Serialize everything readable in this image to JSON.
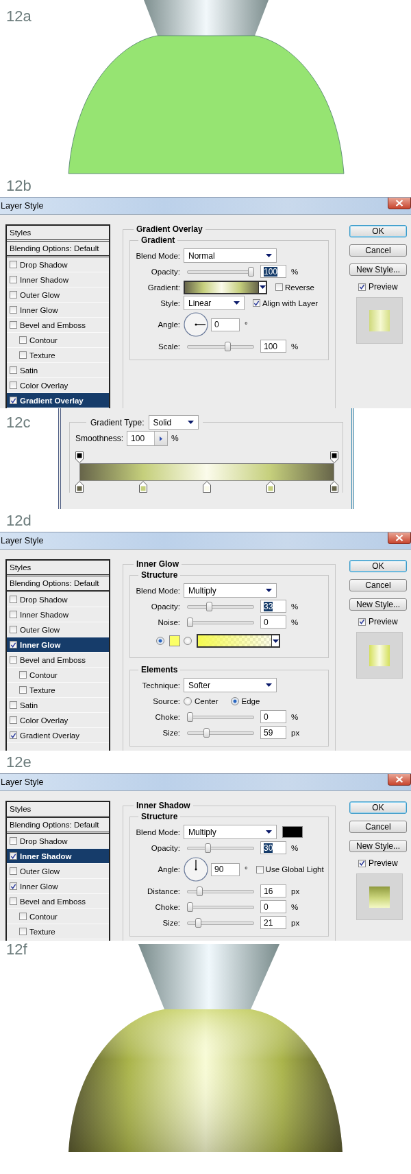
{
  "steps": [
    {
      "label": "12a",
      "kind": "flat_shape"
    },
    {
      "label": "12b",
      "kind": "dialog",
      "title": "Layer Style",
      "styles": {
        "header": "Styles",
        "blending": "Blending Options: Default",
        "items": [
          {
            "label": "Drop Shadow",
            "checked": false,
            "selected": false
          },
          {
            "label": "Inner Shadow",
            "checked": false,
            "selected": false
          },
          {
            "label": "Outer Glow",
            "checked": false,
            "selected": false
          },
          {
            "label": "Inner Glow",
            "checked": false,
            "selected": false
          },
          {
            "label": "Bevel and Emboss",
            "checked": false,
            "selected": false,
            "children": [
              {
                "label": "Contour",
                "checked": false,
                "selected": false
              },
              {
                "label": "Texture",
                "checked": false,
                "selected": false
              }
            ]
          },
          {
            "label": "Satin",
            "checked": false,
            "selected": false
          },
          {
            "label": "Color Overlay",
            "checked": false,
            "selected": false
          },
          {
            "label": "Gradient Overlay",
            "checked": true,
            "selected": true
          }
        ]
      },
      "panel": {
        "title": "Gradient Overlay",
        "groups": [
          {
            "title": "Gradient",
            "rows": [
              {
                "kind": "select",
                "label": "Blend Mode:",
                "value": "Normal"
              },
              {
                "kind": "slider",
                "label": "Opacity:",
                "level": 1.0,
                "value": "100",
                "unit": "%",
                "highlighted": true
              },
              {
                "kind": "gradient",
                "label": "Gradient:",
                "checkbox": {
                  "label": "Reverse",
                  "checked": false
                }
              },
              {
                "kind": "select",
                "label": "Style:",
                "value": "Linear",
                "checkbox": {
                  "label": "Align with Layer",
                  "checked": true
                }
              },
              {
                "kind": "angle",
                "label": "Angle:",
                "value": "0",
                "unit": "°"
              },
              {
                "kind": "slider",
                "label": "Scale:",
                "level": 0.62,
                "value": "100",
                "unit": "%",
                "highlighted": false
              }
            ]
          }
        ]
      },
      "buttons": [
        {
          "label": "OK",
          "default": true
        },
        {
          "label": "Cancel",
          "default": false
        },
        {
          "label": "New Style...",
          "default": false
        }
      ],
      "preview": {
        "label": "Preview",
        "checked": true,
        "kind": "gradient"
      }
    },
    {
      "label": "12c",
      "kind": "gradient_editor",
      "type_label": "Gradient Type:",
      "type_value": "Solid",
      "smoothness_label": "Smoothness:",
      "smoothness_value": "100",
      "smoothness_unit": "%",
      "color_stops": [
        {
          "color": "#67654a"
        },
        {
          "color": "#c5cf7c"
        },
        {
          "color": "#fbfbeb"
        },
        {
          "color": "#c5cf7c"
        },
        {
          "color": "#67654a"
        }
      ]
    },
    {
      "label": "12d",
      "kind": "dialog",
      "title": "Layer Style",
      "styles": {
        "header": "Styles",
        "blending": "Blending Options: Default",
        "items": [
          {
            "label": "Drop Shadow",
            "checked": false,
            "selected": false
          },
          {
            "label": "Inner Shadow",
            "checked": false,
            "selected": false
          },
          {
            "label": "Outer Glow",
            "checked": false,
            "selected": false
          },
          {
            "label": "Inner Glow",
            "checked": true,
            "selected": true
          },
          {
            "label": "Bevel and Emboss",
            "checked": false,
            "selected": false,
            "children": [
              {
                "label": "Contour",
                "checked": false,
                "selected": false
              },
              {
                "label": "Texture",
                "checked": false,
                "selected": false
              }
            ]
          },
          {
            "label": "Satin",
            "checked": false,
            "selected": false
          },
          {
            "label": "Color Overlay",
            "checked": false,
            "selected": false
          },
          {
            "label": "Gradient Overlay",
            "checked": true,
            "selected": false
          }
        ]
      },
      "panel": {
        "title": "Inner Glow",
        "groups": [
          {
            "title": "Structure",
            "rows": [
              {
                "kind": "select",
                "label": "Blend Mode:",
                "value": "Multiply"
              },
              {
                "kind": "slider",
                "label": "Opacity:",
                "level": 0.32,
                "value": "33",
                "unit": "%",
                "highlighted": true
              },
              {
                "kind": "slider",
                "label": "Noise:",
                "level": 0,
                "value": "0",
                "unit": "%",
                "highlighted": false
              },
              {
                "kind": "color_choice",
                "options": [
                  {
                    "kind": "swatch",
                    "selected": true,
                    "color": "#fbff66"
                  },
                  {
                    "kind": "gradient",
                    "selected": false
                  }
                ]
              }
            ]
          },
          {
            "title": "Elements",
            "rows": [
              {
                "kind": "select",
                "label": "Technique:",
                "value": "Softer"
              },
              {
                "kind": "radio",
                "label": "Source:",
                "options": [
                  {
                    "label": "Center",
                    "selected": false
                  },
                  {
                    "label": "Edge",
                    "selected": true
                  }
                ]
              },
              {
                "kind": "slider",
                "label": "Choke:",
                "level": 0,
                "value": "0",
                "unit": "%",
                "highlighted": false
              },
              {
                "kind": "slider",
                "label": "Size:",
                "level": 0.27,
                "value": "59",
                "unit": "px",
                "highlighted": false
              }
            ]
          }
        ]
      },
      "buttons": [
        {
          "label": "OK",
          "default": true
        },
        {
          "label": "Cancel",
          "default": false
        },
        {
          "label": "New Style...",
          "default": false
        }
      ],
      "preview": {
        "label": "Preview",
        "checked": true,
        "kind": "glow"
      }
    },
    {
      "label": "12e",
      "kind": "dialog",
      "title": "Layer Style",
      "styles": {
        "header": "Styles",
        "blending": "Blending Options: Default",
        "items": [
          {
            "label": "Drop Shadow",
            "checked": false,
            "selected": false
          },
          {
            "label": "Inner Shadow",
            "checked": true,
            "selected": true
          },
          {
            "label": "Outer Glow",
            "checked": false,
            "selected": false
          },
          {
            "label": "Inner Glow",
            "checked": true,
            "selected": false
          },
          {
            "label": "Bevel and Emboss",
            "checked": false,
            "selected": false,
            "children": [
              {
                "label": "Contour",
                "checked": false,
                "selected": false
              },
              {
                "label": "Texture",
                "checked": false,
                "selected": false
              }
            ]
          }
        ]
      },
      "panel": {
        "title": "Inner Shadow",
        "groups": [
          {
            "title": "Structure",
            "rows": [
              {
                "kind": "select",
                "label": "Blend Mode:",
                "value": "Multiply",
                "color": "#000000"
              },
              {
                "kind": "slider",
                "label": "Opacity:",
                "level": 0.29,
                "value": "30",
                "unit": "%",
                "highlighted": true
              },
              {
                "kind": "angle",
                "label": "Angle:",
                "value": "90",
                "unit": "°",
                "checkbox": {
                  "label": "Use Global Light",
                  "checked": false
                }
              },
              {
                "kind": "slider",
                "label": "Distance:",
                "level": 0.16,
                "value": "16",
                "unit": "px",
                "highlighted": false
              },
              {
                "kind": "slider",
                "label": "Choke:",
                "level": 0,
                "value": "0",
                "unit": "%",
                "highlighted": false
              },
              {
                "kind": "slider",
                "label": "Size:",
                "level": 0.14,
                "value": "21",
                "unit": "px",
                "highlighted": false
              }
            ]
          }
        ]
      },
      "buttons": [
        {
          "label": "OK",
          "default": true
        },
        {
          "label": "Cancel",
          "default": false
        },
        {
          "label": "New Style...",
          "default": false
        }
      ],
      "preview": {
        "label": "Preview",
        "checked": true,
        "kind": "shadow"
      }
    },
    {
      "label": "12f",
      "kind": "shaded_shape"
    }
  ]
}
